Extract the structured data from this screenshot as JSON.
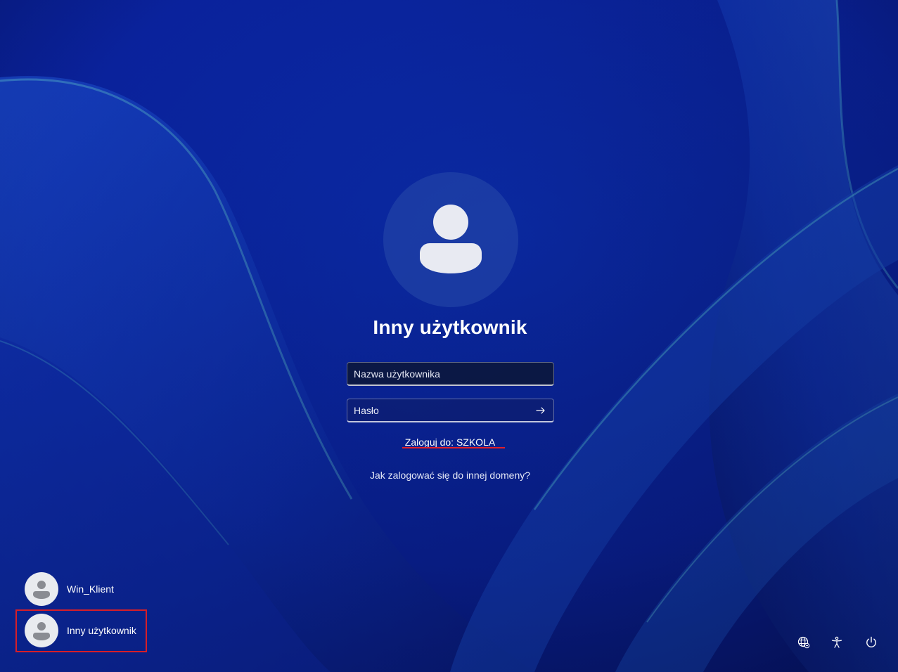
{
  "login": {
    "title": "Inny użytkownik",
    "username_placeholder": "Nazwa użytkownika",
    "password_placeholder": "Hasło",
    "signin_domain": "Zaloguj do: SZKOLA",
    "other_domain_help": "Jak zalogować się do innej domeny?",
    "submit_icon": "arrow-right-icon"
  },
  "users": [
    {
      "name": "Win_Klient",
      "icon": "user-avatar-icon"
    },
    {
      "name": "Inny użytkownik",
      "icon": "user-avatar-icon",
      "highlighted": true
    }
  ],
  "system_tray": [
    {
      "icon": "network-icon"
    },
    {
      "icon": "accessibility-icon"
    },
    {
      "icon": "power-icon"
    }
  ],
  "colors": {
    "background": "#0b1f9a",
    "highlight_border": "#d71e28",
    "text": "#ffffff"
  }
}
